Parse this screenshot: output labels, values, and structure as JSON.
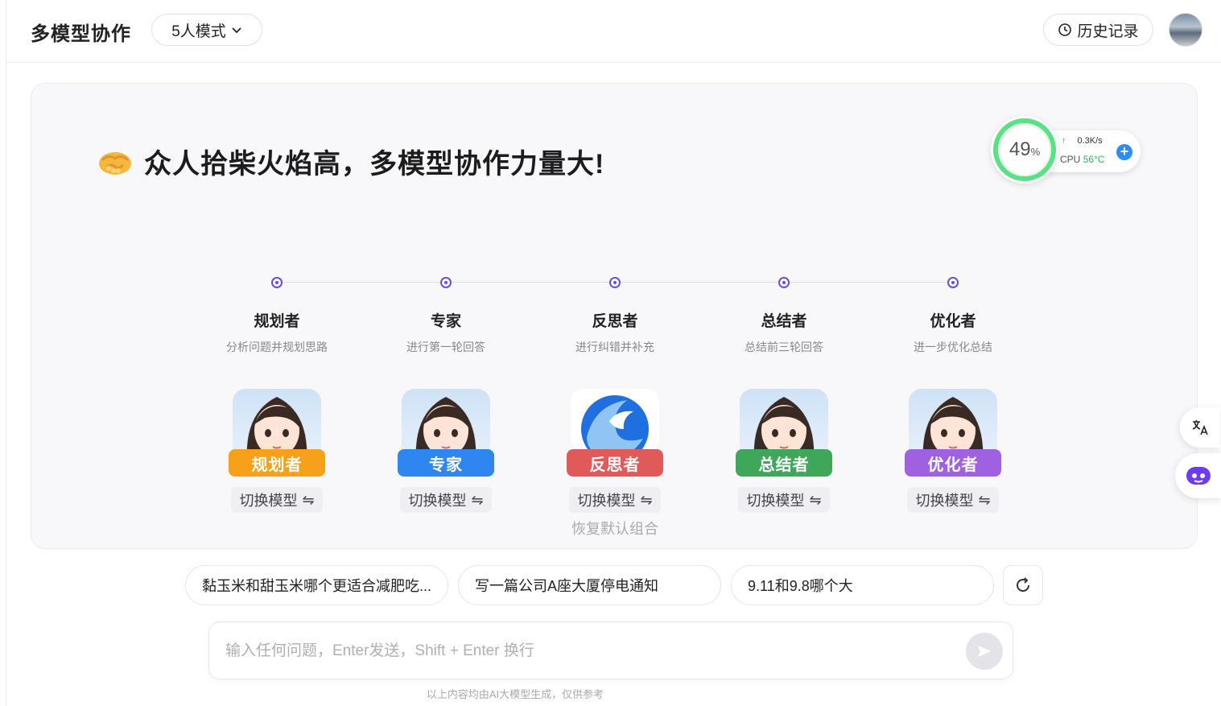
{
  "header": {
    "title": "多模型协作",
    "mode_label": "5人模式",
    "history_label": "历史记录"
  },
  "hero": {
    "icon": "handshake-icon",
    "text": "众人拾柴火焰高，多模型协作力量大!"
  },
  "monitor": {
    "percent": "49",
    "percent_unit": "%",
    "net_speed": "0.3K/s",
    "cpu_label": "CPU",
    "cpu_temp": "56°C",
    "colors": {
      "ring": "#3ddc6f",
      "temp": "#2fb35a",
      "plus": "#2b8ef0"
    }
  },
  "roles": [
    {
      "name": "规划者",
      "desc": "分析问题并规划思路",
      "badge": "规划者",
      "badge_color": "#f7a11a",
      "switch_label": "切换模型",
      "avatar": "girl-avatar"
    },
    {
      "name": "专家",
      "desc": "进行第一轮回答",
      "badge": "专家",
      "badge_color": "#2f86f0",
      "switch_label": "切换模型",
      "avatar": "girl-avatar"
    },
    {
      "name": "反思者",
      "desc": "进行纠错并补充",
      "badge": "反思者",
      "badge_color": "#e05a5a",
      "switch_label": "切换模型",
      "avatar": "blue-swirl-logo",
      "restore_label": "恢复默认组合"
    },
    {
      "name": "总结者",
      "desc": "总结前三轮回答",
      "badge": "总结者",
      "badge_color": "#3fa65a",
      "switch_label": "切换模型",
      "avatar": "girl-avatar"
    },
    {
      "name": "优化者",
      "desc": "进一步优化总结",
      "badge": "优化者",
      "badge_color": "#a061e0",
      "switch_label": "切换模型",
      "avatar": "girl-avatar"
    }
  ],
  "suggestions": [
    "黏玉米和甜玉米哪个更适合减肥吃...",
    "写一篇公司A座大厦停电通知",
    "9.11和9.8哪个大"
  ],
  "input": {
    "placeholder": "输入任何问题，Enter发送，Shift + Enter 换行"
  },
  "disclaimer": "以上内容均由AI大模型生成，仅供参考"
}
